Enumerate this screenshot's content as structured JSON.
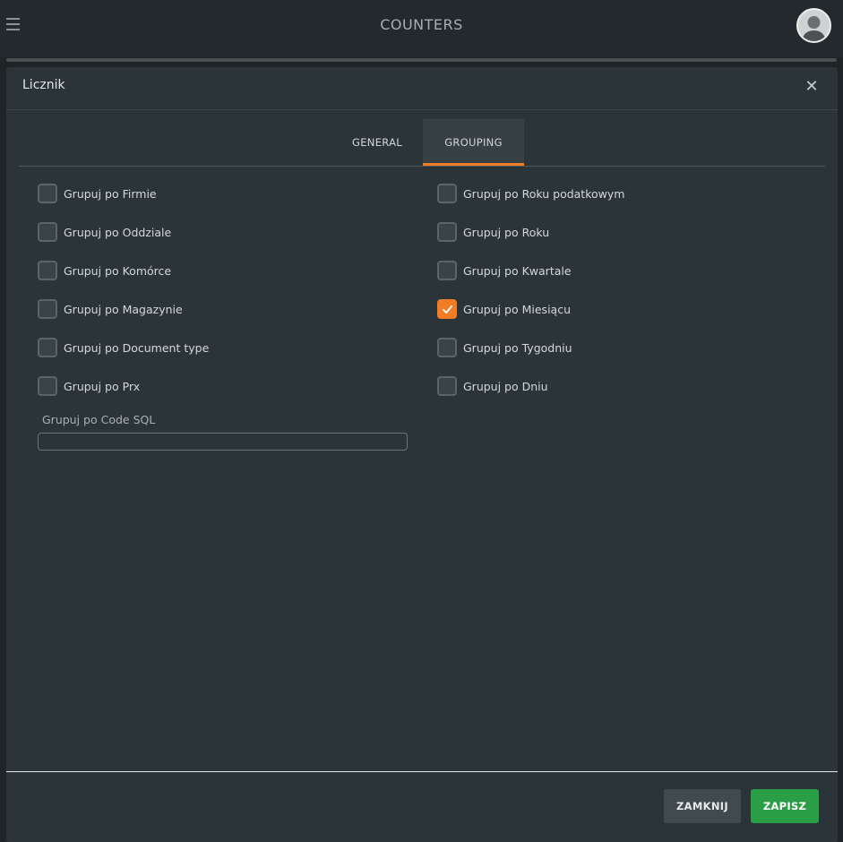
{
  "app": {
    "title": "COUNTERS"
  },
  "modal": {
    "title": "Licznik",
    "close_symbol": "✕",
    "tabs": [
      {
        "label": "GENERAL",
        "active": false
      },
      {
        "label": "GROUPING",
        "active": true
      }
    ]
  },
  "left_checkboxes": [
    {
      "label": "Grupuj po Firmie",
      "checked": false
    },
    {
      "label": "Grupuj po Oddziale",
      "checked": false
    },
    {
      "label": "Grupuj po Komórce",
      "checked": false
    },
    {
      "label": "Grupuj po Magazynie",
      "checked": false
    },
    {
      "label": "Grupuj po Document type",
      "checked": false
    },
    {
      "label": "Grupuj po Prx",
      "checked": false
    }
  ],
  "right_checkboxes": [
    {
      "label": "Grupuj po Roku podatkowym",
      "checked": false
    },
    {
      "label": "Grupuj po Roku",
      "checked": false
    },
    {
      "label": "Grupuj po Kwartale",
      "checked": false
    },
    {
      "label": "Grupuj po Miesiącu",
      "checked": true
    },
    {
      "label": "Grupuj po Tygodniu",
      "checked": false
    },
    {
      "label": "Grupuj po Dniu",
      "checked": false
    }
  ],
  "code_sql": {
    "label": "Grupuj po Code SQL",
    "value": ""
  },
  "footer": {
    "close_label": "ZAMKNIJ",
    "save_label": "ZAPISZ"
  },
  "colors": {
    "accent": "#f07c26",
    "save": "#2a9e46",
    "background": "#2b3438"
  }
}
